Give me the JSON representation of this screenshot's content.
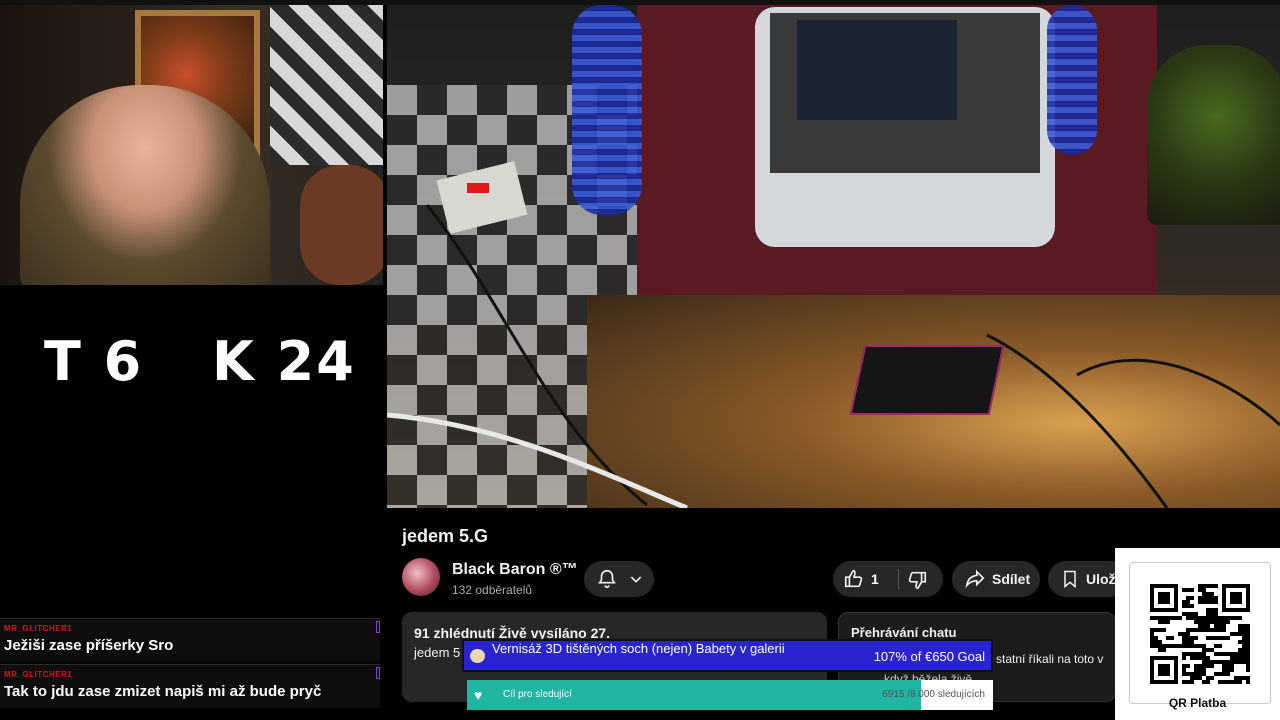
{
  "overlay": {
    "counters": {
      "t_label": "T 6",
      "k_label": "K 24"
    },
    "chat_messages": [
      {
        "user": "MR_GLITCHER1",
        "text": "Ježiši zase příšerky Sro"
      },
      {
        "user": "MR_GLITCHER1",
        "text": "Tak to jdu zase zmizet napiš mi až bude pryč"
      }
    ],
    "goal": {
      "title": "Vernisáž 3D tištěných soch (nejen) Babety v galerii",
      "progress_text": "107% of €650 Goal",
      "progress": 1.0
    },
    "followers": {
      "label": "Cíl pro sledující",
      "count_text": "6915 /8 000 sledujících",
      "progress": 0.864
    },
    "qr": {
      "label": "QR Platba"
    }
  },
  "video": {
    "title": "jedem 5.G",
    "channel": {
      "name": "Black Baron ®™",
      "subscribers": "132 odběratelů"
    },
    "like_count": "1",
    "share_label": "Sdílet",
    "save_label": "Ulož",
    "views_line": "91 zhlédnutí  Živě vysíláno 27.",
    "description_snippet": "jedem 5",
    "chat_replay_label": "Přehrávání chatu",
    "chat_snippet": "statní říkali na toto v",
    "chat_snippet2": "když běžela živě"
  },
  "colors": {
    "goal_bar": "#1e1ab0",
    "follow_fill": "#1fb5a0",
    "chat_user": "#dd1111",
    "pill_bg": "#272727"
  },
  "icons": [
    "bell-icon",
    "chevron-down-icon",
    "thumbs-up-icon",
    "thumbs-down-icon",
    "share-icon",
    "bookmark-icon",
    "piggy-icon",
    "follower-icon"
  ]
}
